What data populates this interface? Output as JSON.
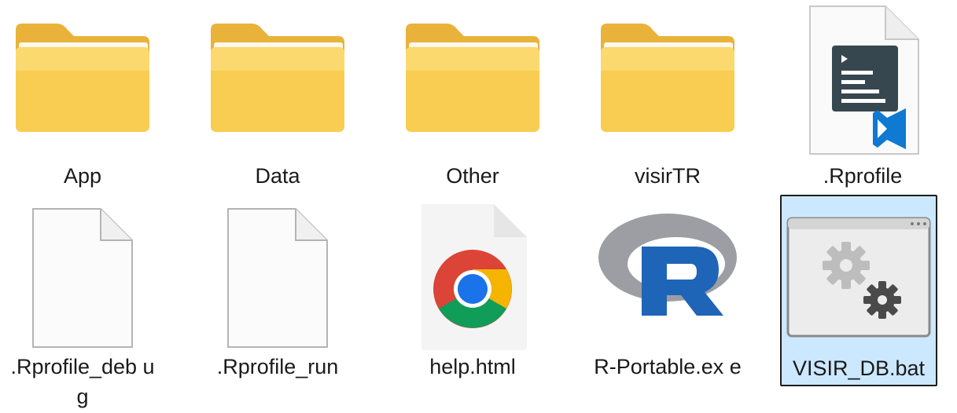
{
  "items": [
    {
      "name": "App",
      "kind": "folder"
    },
    {
      "name": "Data",
      "kind": "folder"
    },
    {
      "name": "Other",
      "kind": "folder"
    },
    {
      "name": "visirTR",
      "kind": "folder"
    },
    {
      "name": ".Rprofile",
      "kind": "vscode-file"
    },
    {
      "name": ".Rprofile_deb ug",
      "kind": "blank-file"
    },
    {
      "name": ".Rprofile_run",
      "kind": "blank-file"
    },
    {
      "name": "help.html",
      "kind": "chrome-html-file"
    },
    {
      "name": "R-Portable.ex e",
      "kind": "r-app"
    },
    {
      "name": "VISIR_DB.bat",
      "kind": "batch-file",
      "selected": true
    }
  ],
  "icons": {
    "folder": "folder-icon",
    "vscode_file": "vscode-file-icon",
    "blank_file": "blank-file-icon",
    "chrome": "chrome-icon",
    "r_logo": "r-logo-icon",
    "batch": "batch-gears-icon"
  },
  "colors": {
    "selection_bg": "#cce8ff",
    "folder_yellow": "#f7c843",
    "folder_light": "#fde59a",
    "r_blue": "#1f65b7",
    "vscode_blue": "#0e7ad1"
  }
}
